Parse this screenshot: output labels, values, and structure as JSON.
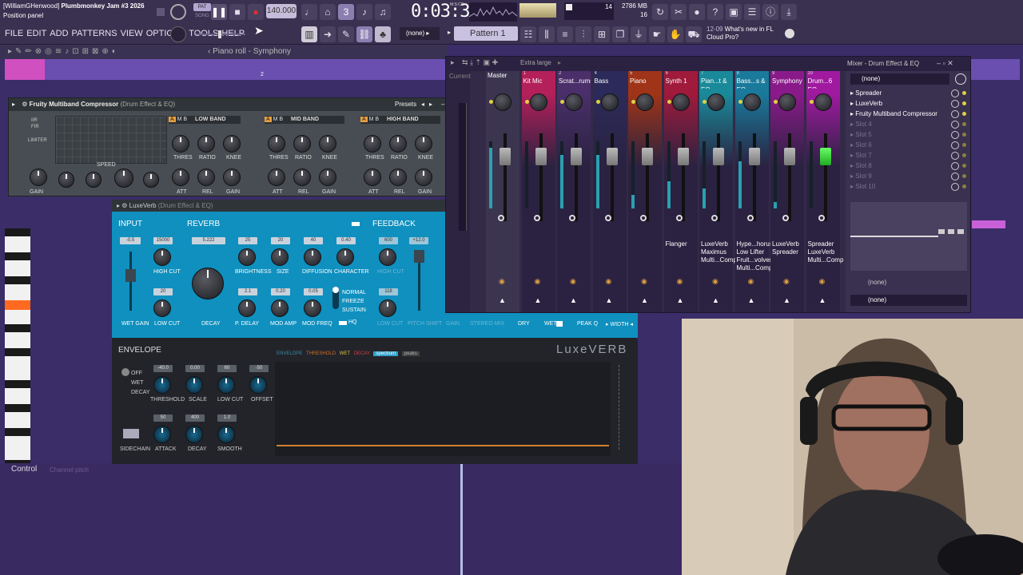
{
  "app": {
    "title_user": "[WilliamGHenwood]",
    "title_song": "Plumbmonkey Jam #3 2026",
    "hint": "Position panel",
    "tempo": "140.000",
    "time": "0:03:33",
    "time_unit": "M:S:CS",
    "pat_label": "PAT",
    "song_label": "SONG",
    "cpu": "14",
    "ram": "2786 MB",
    "voices": "16",
    "pattern": "Pattern 1",
    "preset_none": "(none)",
    "news_date": "12-09",
    "news_title": "What's new in FL",
    "news_sub": "Cloud Pro?"
  },
  "menu": [
    "FILE",
    "EDIT",
    "ADD",
    "PATTERNS",
    "VIEW",
    "OPTIONS",
    "TOOLS",
    "HELP"
  ],
  "pianoroll": {
    "title": "Piano roll - Symphony",
    "bar2": "2",
    "control": "Control",
    "channel": "Channel pitch"
  },
  "compressor": {
    "title": "Fruity Multiband Compressor",
    "subtitle": "(Drum Effect & EQ)",
    "presets": "Presets",
    "iir": "IIR",
    "fir": "FIR",
    "limiter": "LIMITER",
    "speed": "SPEED",
    "gain": "GAIN",
    "bands": [
      "LOW BAND",
      "MID BAND",
      "HIGH BAND"
    ],
    "knob_labels_top": [
      "THRES",
      "RATIO",
      "KNEE"
    ],
    "knob_labels_bot": [
      "ATT",
      "REL",
      "GAIN"
    ],
    "amb": [
      "A",
      "M",
      "B"
    ]
  },
  "luxeverb": {
    "title": "LuxeVerb",
    "subtitle": "(Drum Effect & EQ)",
    "input": "INPUT",
    "reverb": "REVERB",
    "feedback": "FEEDBACK",
    "envelope": "ENVELOPE",
    "brand": "LuxeVERB",
    "values": {
      "wet_gain": "-0.5",
      "high_cut": "15000",
      "low_cut": "20",
      "decay": "5.222",
      "brightness": "25",
      "size": "20",
      "diffusion": "40",
      "character": "0.40",
      "p_delay": "2.1",
      "mod_amp": "0.20",
      "mod_freq": "0.05",
      "fb_high": "600",
      "fb_low": "118",
      "fb_pitch": "+12.0",
      "threshold": "-40.0",
      "scale": "0.00",
      "env_low_cut": "60",
      "offset": "-50",
      "attack": "50",
      "env_decay": "400",
      "smooth": "1.0"
    },
    "labels": {
      "wet_gain": "WET GAIN",
      "high_cut": "HIGH CUT",
      "low_cut": "LOW CUT",
      "decay": "DECAY",
      "brightness": "BRIGHTNESS",
      "size": "SIZE",
      "diffusion": "DIFFUSION",
      "character": "CHARACTER",
      "p_delay": "P. DELAY",
      "mod_amp": "MOD AMP",
      "mod_freq": "MOD FREQ",
      "normal": "NORMAL",
      "freeze": "FREEZE",
      "sustain": "SUSTAIN",
      "hq": "HQ",
      "high_cut2": "HIGH CUT",
      "low_cut2": "LOW CUT",
      "pitch_shift": "PITCH SHIFT",
      "gain": "GAIN",
      "stereo_mix": "STEREO MIX",
      "dry": "DRY",
      "wet": "WET",
      "peak_q": "PEAK Q",
      "width": "WIDTH",
      "off": "OFF",
      "wet2": "WET",
      "decay2": "DECAY",
      "threshold": "THRESHOLD",
      "scale": "SCALE",
      "env_low_cut": "LOW CUT",
      "offset": "OFFSET",
      "sidechain": "SIDECHAIN",
      "attack": "ATTACK",
      "env_decay": "DECAY",
      "smooth": "SMOOTH"
    },
    "tabs": [
      "ENVELOPE",
      "THRESHOLD",
      "WET",
      "DECAY"
    ],
    "tab_spectrum": "spectrum",
    "tab_peaks": "peaks"
  },
  "mixer": {
    "size": "Extra large",
    "title": "Mixer - Drum Effect & EQ",
    "current": "Current",
    "strips": [
      {
        "num": "",
        "name": "Master",
        "color": "#3c3550",
        "insert": ""
      },
      {
        "num": "1",
        "name": "Kit Mic",
        "color": "#b4205a",
        "insert": ""
      },
      {
        "num": "2",
        "name": "Scrat...rums",
        "color": "#4a2f6a",
        "insert": ""
      },
      {
        "num": "4",
        "name": "Bass",
        "color": "#2c2a5a",
        "insert": ""
      },
      {
        "num": "5",
        "name": "Piano",
        "color": "#a03418",
        "insert": ""
      },
      {
        "num": "6",
        "name": "Synth 1",
        "color": "#a01a3c",
        "insert": "Flanger"
      },
      {
        "num": "7",
        "name": "Pian...t & EQ",
        "color": "#1a8a9a",
        "insert": "LuxeVerb Maximus Multi...Comp"
      },
      {
        "num": "8",
        "name": "Bass...s & EQ",
        "color": "#1a7a9c",
        "insert": "Hype...horus Low Lifter Fruit...volver Multi...Comp"
      },
      {
        "num": "9",
        "name": "Symphony",
        "color": "#8a1a8a",
        "insert": "LuxeVerb Spreader"
      },
      {
        "num": "10",
        "name": "Drum...6 EQ",
        "color": "#a01aa0",
        "insert": "Spreader LuxeVerb Multi...Comp"
      }
    ],
    "slot_none": "(none)",
    "slots": [
      "Spreader",
      "LuxeVerb",
      "Fruity Multiband Compressor",
      "Slot 4",
      "Slot 5",
      "Slot 6",
      "Slot 7",
      "Slot 8",
      "Slot 9",
      "Slot 10"
    ],
    "bottom_none1": "(none)",
    "bottom_none2": "(none)"
  }
}
